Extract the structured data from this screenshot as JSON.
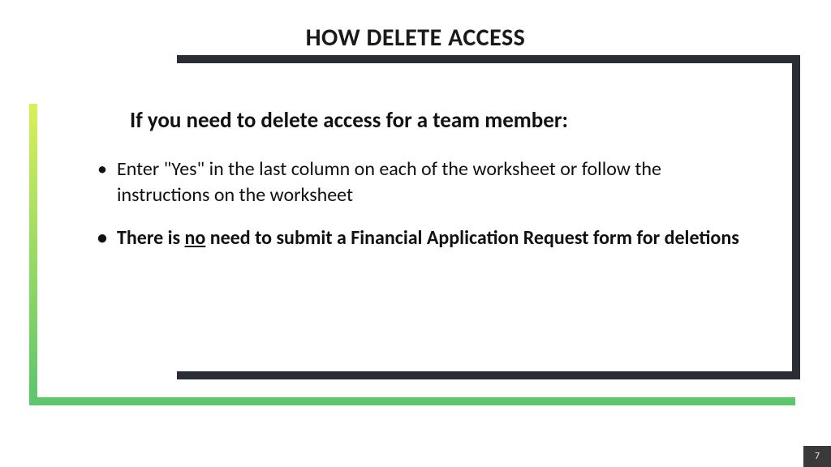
{
  "title": "HOW DELETE ACCESS",
  "subhead": "If you need to delete access for a team member:",
  "bullets": {
    "b0": "Enter \"Yes\" in the last column on each of the worksheet or follow the instructions on the worksheet",
    "b1_pre": "There is ",
    "b1_u": "no",
    "b1_post": " need to submit a Financial Application Request form for deletions"
  },
  "page_number": "7"
}
